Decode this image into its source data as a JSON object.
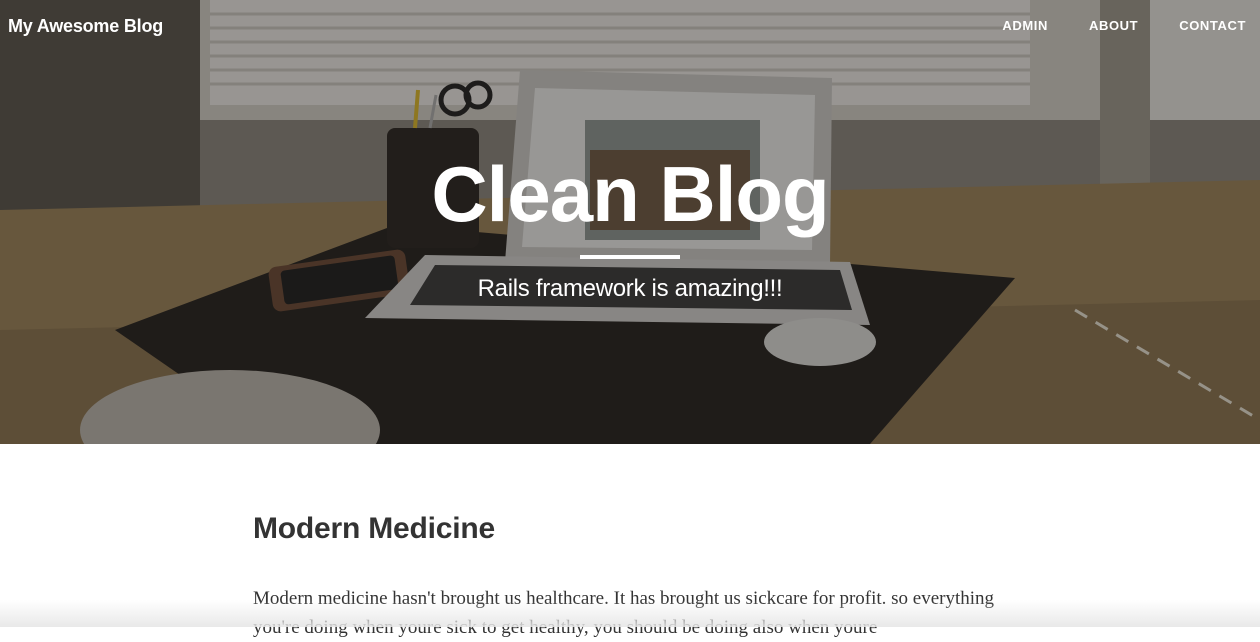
{
  "navbar": {
    "brand": "My Awesome Blog",
    "links": [
      {
        "label": "ADMIN"
      },
      {
        "label": "ABOUT"
      },
      {
        "label": "CONTACT"
      }
    ]
  },
  "hero": {
    "title": "Clean Blog",
    "subtitle": "Rails framework is amazing!!!"
  },
  "post": {
    "title": "Modern Medicine",
    "text": "Modern medicine hasn't brought us healthcare. It has brought us sickcare for profit. so everything you're doing when youre sick to get healthy, you should be doing also when youre"
  }
}
